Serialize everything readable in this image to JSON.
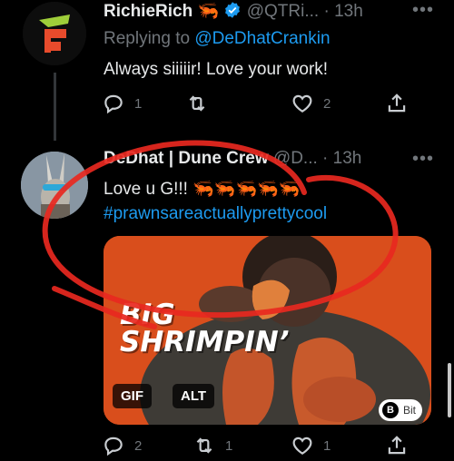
{
  "tweet1": {
    "display_name": "RichieRich",
    "emoji": "🦐",
    "handle": "@QTRi...",
    "time_sep": "·",
    "time": "13h",
    "more": "•••",
    "replying_prefix": "Replying to ",
    "replying_handle": "@DeDhatCrankin",
    "body": "Always siiiiir! Love your work!",
    "reply_count": "1",
    "retweet_count": "",
    "like_count": "2"
  },
  "tweet2": {
    "display_name": "DeDhat | Dune Crew",
    "handle": "@D...",
    "time_sep": "·",
    "time": "13h",
    "more": "•••",
    "body_text": "Love u G!!! ",
    "body_emojis": [
      "🦐",
      "🦐",
      "🦐",
      "🦐",
      "🦐"
    ],
    "hashtag": "#prawnsareactuallyprettycool",
    "media": {
      "title_line1": "BIG",
      "title_line2": "SHRIMPIN’",
      "gif_badge": "GIF",
      "alt_badge": "ALT",
      "brand_mark": "B",
      "brand_label": "Bit"
    },
    "reply_count": "2",
    "retweet_count": "1",
    "like_count": "1"
  },
  "colors": {
    "background": "#000000",
    "text": "#e7e9ea",
    "muted": "#71767b",
    "link": "#1d9bf0",
    "annotation": "#e8281f"
  }
}
